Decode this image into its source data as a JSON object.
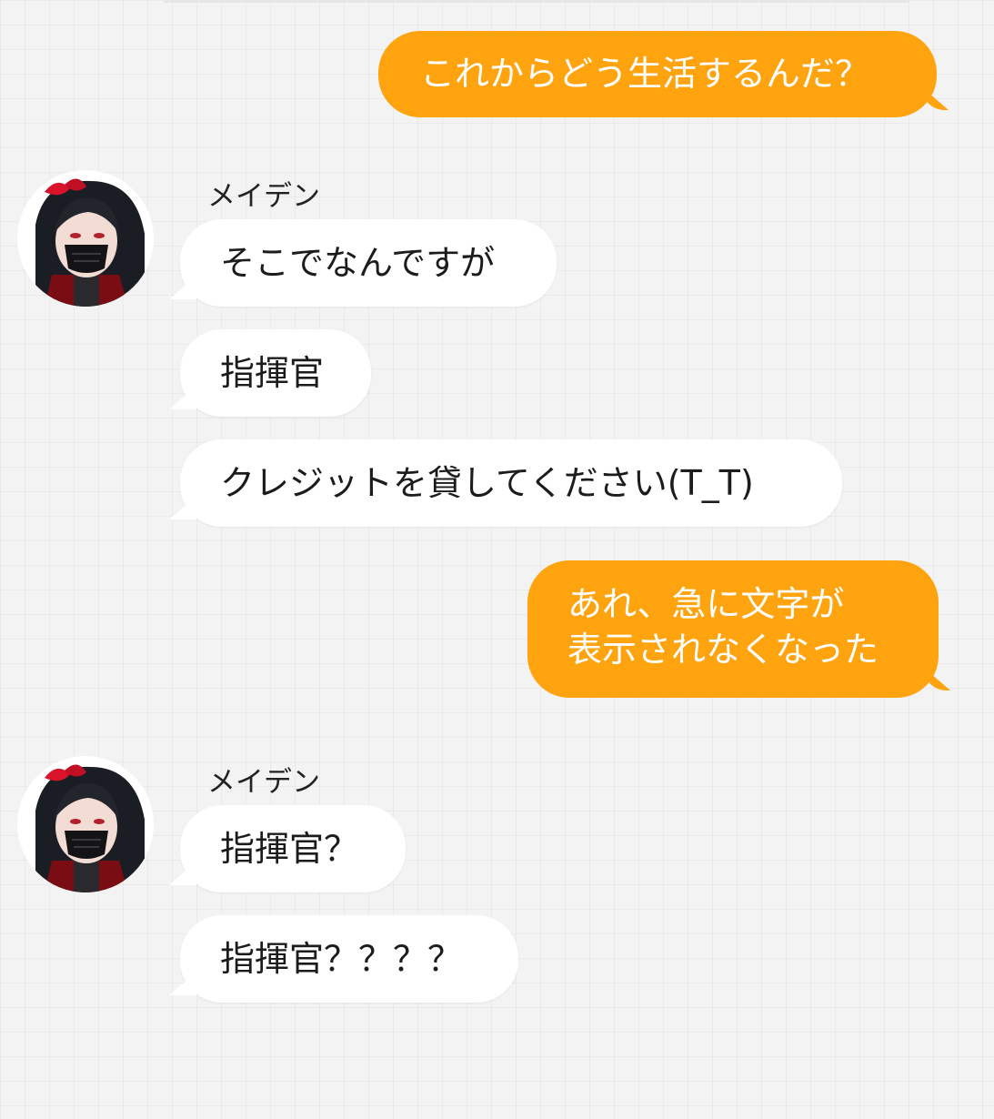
{
  "chat": {
    "messages": [
      {
        "side": "out",
        "text": "これからどう生活するんだ？"
      },
      {
        "side": "in",
        "sender": "メイデン",
        "text": "そこでなんですが"
      },
      {
        "side": "in",
        "text": "指揮官"
      },
      {
        "side": "in",
        "text": "クレジットを貸してください(T_T)"
      },
      {
        "side": "out",
        "lines": [
          "あれ、急に文字が",
          "表示されなくなった"
        ]
      },
      {
        "side": "in",
        "sender": "メイデン",
        "text": "指揮官？"
      },
      {
        "side": "in",
        "text": "指揮官？？？？"
      }
    ]
  },
  "colors": {
    "outgoing_bubble": "#ffa30f",
    "incoming_bubble": "#ffffff",
    "background": "#f3f3f3"
  },
  "icons": {
    "avatar": "character-avatar"
  }
}
